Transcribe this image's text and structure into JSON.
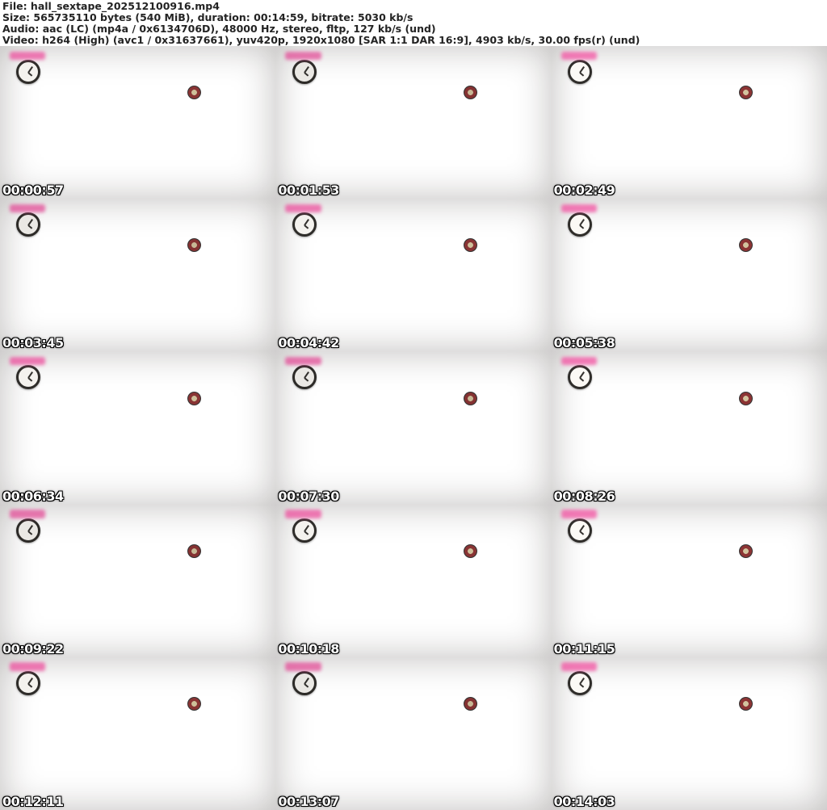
{
  "header": {
    "file": "File: hall_sextape_202512100916.mp4",
    "size": "Size: 565735110 bytes (540 MiB), duration: 00:14:59, bitrate: 5030 kb/s",
    "audio": "Audio: aac (LC) (mp4a / 0x6134706D), 48000 Hz, stereo, fltp, 127 kb/s (und)",
    "video": "Video: h264 (High) (avc1 / 0x31637661), yuv420p, 1920x1080 [SAR 1:1 DAR 16:9], 4903 kb/s, 30.00 fps(r) (und)"
  },
  "grid": {
    "columns": 3,
    "rows": 5,
    "thumbnail_count": 15
  },
  "thumbnails": [
    {
      "timestamp": "00:00:57"
    },
    {
      "timestamp": "00:01:53"
    },
    {
      "timestamp": "00:02:49"
    },
    {
      "timestamp": "00:03:45"
    },
    {
      "timestamp": "00:04:42"
    },
    {
      "timestamp": "00:05:38"
    },
    {
      "timestamp": "00:06:34"
    },
    {
      "timestamp": "00:07:30"
    },
    {
      "timestamp": "00:08:26"
    },
    {
      "timestamp": "00:09:22"
    },
    {
      "timestamp": "00:10:18"
    },
    {
      "timestamp": "00:11:15"
    },
    {
      "timestamp": "00:12:11"
    },
    {
      "timestamp": "00:13:07"
    },
    {
      "timestamp": "00:14:03"
    }
  ],
  "colors": {
    "header_bg": "#ffffff",
    "header_text": "#232323",
    "timestamp_text": "#ffffff",
    "timestamp_outline": "#000000",
    "tree_green": "#2c6e52",
    "ornament_blue": "#2f5fc9",
    "watermark_pink": "#ec509e",
    "shelf_dark": "#171210",
    "lamp_glow": "#ffd882"
  }
}
